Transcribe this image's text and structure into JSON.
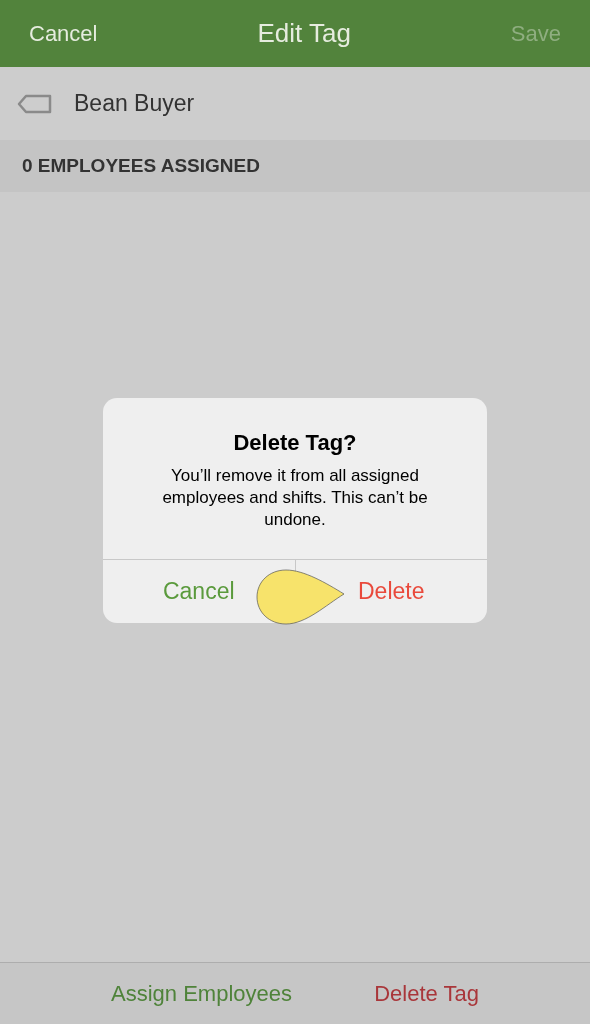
{
  "nav_bar": {
    "cancel": "Cancel",
    "title": "Edit Tag",
    "save": {
      "label": "Save",
      "disabled": true
    }
  },
  "tag": {
    "name": "Bean Buyer"
  },
  "section_header": "0 EMPLOYEES ASSIGNED",
  "dialog": {
    "title": "Delete Tag?",
    "message": "You’ll remove it from all assigned employees and shifts. This can’t be undone.",
    "buttons": [
      {
        "label": "Cancel",
        "kind": "cancel"
      },
      {
        "label": "Delete",
        "kind": "destructive"
      }
    ],
    "tap_hint": {
      "kind": "pointer"
    }
  },
  "bottom_bar": [
    {
      "label": "Assign Employees",
      "kind": "primary"
    },
    {
      "label": "Delete Tag",
      "kind": "destructive"
    }
  ]
}
